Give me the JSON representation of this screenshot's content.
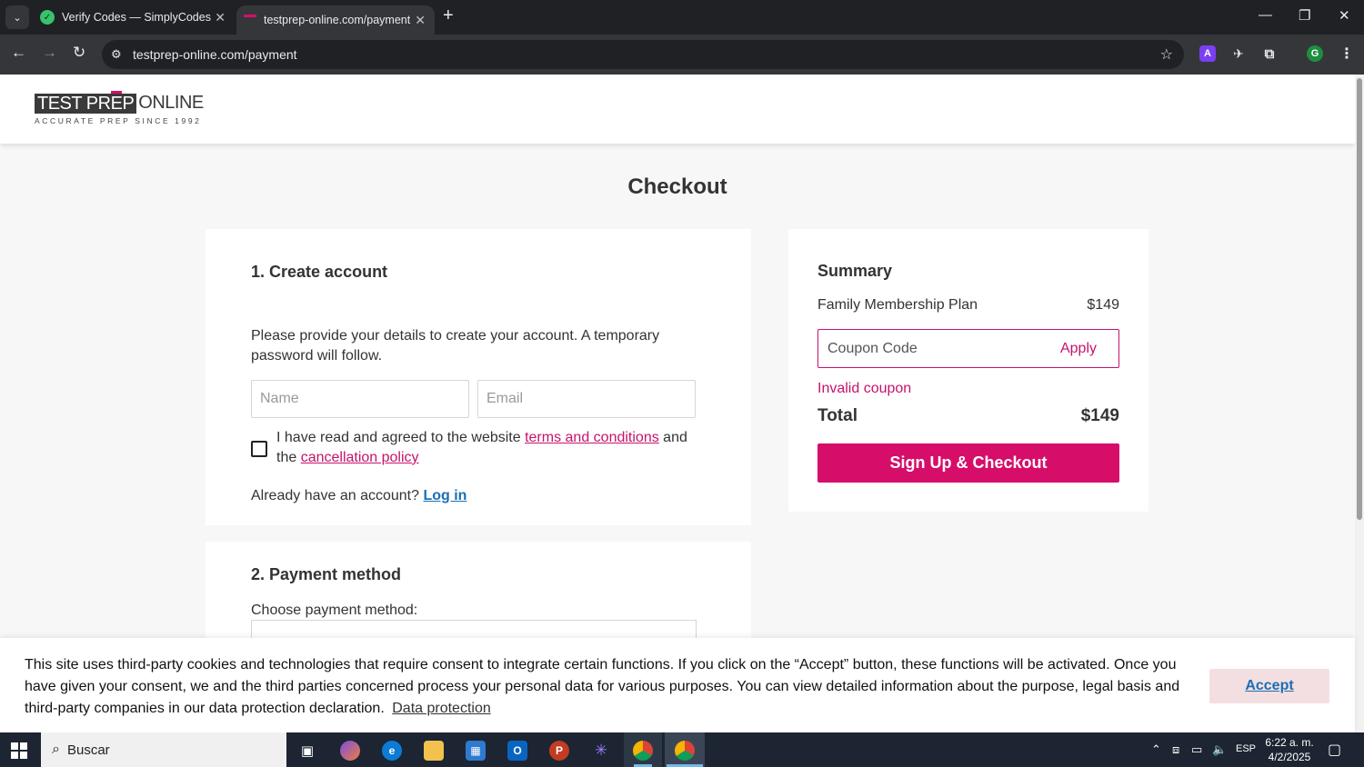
{
  "browser": {
    "tabs": [
      {
        "title": "Verify Codes — SimplyCodes",
        "active": false
      },
      {
        "title": "testprep-online.com/payment",
        "active": true
      }
    ],
    "url": "testprep-online.com/payment",
    "profile_initial": "G",
    "extension_letter": "A"
  },
  "site": {
    "logo_left": "TEST PR",
    "logo_mid": "E",
    "logo_p": "P",
    "logo_right": "ONLINE",
    "tagline": "ACCURATE PREP SINCE 1992"
  },
  "checkout": {
    "title": "Checkout",
    "account": {
      "heading": "1. Create account",
      "intro": "Please provide your details to create your account. A temporary password will follow.",
      "name_placeholder": "Name",
      "email_placeholder": "Email",
      "terms_prefix": "I have read and agreed to the website ",
      "terms_link": "terms and conditions",
      "terms_mid": " and the ",
      "cancellation_link": "cancellation policy",
      "login_prompt": "Already have an account? ",
      "login_link": "Log in"
    },
    "payment": {
      "heading": "2. Payment method",
      "choose_label": "Choose payment method:"
    },
    "summary": {
      "heading": "Summary",
      "plan_name": "Family Membership Plan",
      "plan_price": "$149",
      "coupon_placeholder": "Coupon Code",
      "apply_label": "Apply",
      "coupon_error": "Invalid coupon",
      "total_label": "Total",
      "total_value": "$149",
      "checkout_button": "Sign Up & Checkout"
    }
  },
  "cookie_banner": {
    "text": "This site uses third-party cookies and technologies that require consent to integrate certain functions. If you click on the “Accept” button, these functions will be activated. Once you have given your consent, we and the third parties concerned process your personal data for various purposes. You can view detailed information about the purpose, legal basis and third-party companies in our data protection declaration.",
    "link": "Data protection",
    "accept": "Accept"
  },
  "taskbar": {
    "search_placeholder": "Buscar",
    "language": "ESP",
    "time": "6:22 a. m.",
    "date": "4/2/2025"
  },
  "colors": {
    "brand_pink": "#d60e6a",
    "link_blue": "#1a6fb3",
    "error_pink": "#c5136c"
  }
}
